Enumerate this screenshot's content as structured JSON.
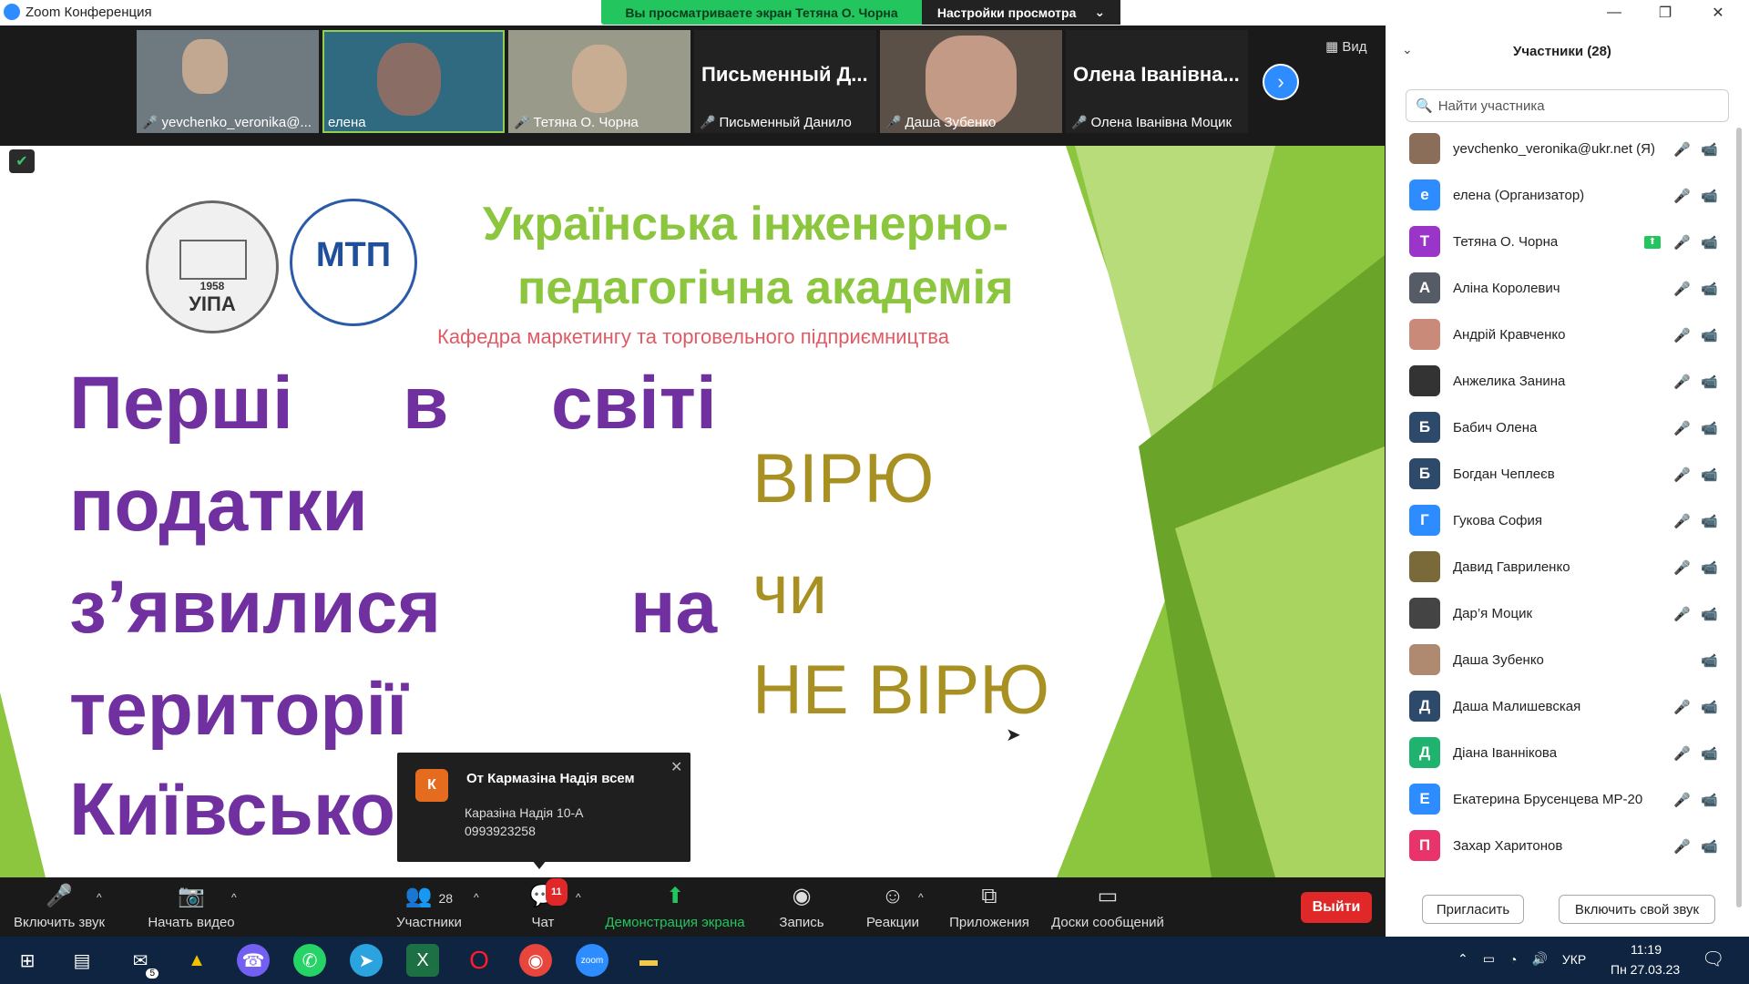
{
  "window": {
    "title": "Zoom Конференция",
    "share_banner": "Вы просматриваете экран Тетяна О. Чорна",
    "view_settings": "Настройки просмотра",
    "minimize": "—",
    "restore": "❐",
    "close": "✕"
  },
  "video_strip": {
    "view_label": "Вид",
    "tiles": [
      {
        "name": "yevchenko_veronika@...",
        "muted": true
      },
      {
        "name": "елена",
        "muted": false
      },
      {
        "name": "Тетяна О. Чорна",
        "muted": true
      },
      {
        "name": "Письменный Данило",
        "big_name": "Письменный Д...",
        "muted": true
      },
      {
        "name": "Даша Зубенко",
        "muted": true
      },
      {
        "name": "Олена Іванівна Моцик",
        "big_name": "Олена Іванівна...",
        "muted": true
      }
    ]
  },
  "slide": {
    "title_line1": "Українська інженерно-",
    "title_line2": "педагогічна академія",
    "subtitle": "Кафедра маркетингу та торговельного підприємництва",
    "logo1_text": "УІПА",
    "logo1_year": "1958",
    "logo2_text": "МТП",
    "words": [
      "Перші",
      "в",
      "світі",
      "податки",
      "з’явилися",
      "на",
      "території",
      "Київсько"
    ],
    "vote_yes": "ВІРЮ",
    "vote_or": "чи",
    "vote_no": "НЕ ВІРЮ"
  },
  "chat_popup": {
    "avatar": "К",
    "from": "От Кармазіна Надія всем",
    "line1": "Каразіна Надія 10-А",
    "line2": "0993923258"
  },
  "toolbar": {
    "unmute": "Включить звук",
    "start_video": "Начать видео",
    "participants": "Участники",
    "participants_count": "28",
    "chat": "Чат",
    "chat_badge": "11",
    "share_screen": "Демонстрация экрана",
    "record": "Запись",
    "reactions": "Реакции",
    "apps": "Приложения",
    "whiteboards": "Доски сообщений",
    "leave": "Выйти"
  },
  "participants_panel": {
    "title": "Участники (28)",
    "search_placeholder": "Найти участника",
    "invite": "Пригласить",
    "unmute_self": "Включить свой звук",
    "people": [
      {
        "name": "yevchenko_veronika@ukr.net (Я)",
        "initial": "",
        "color": "#8a6e5a",
        "mic": "off",
        "cam": "off"
      },
      {
        "name": "елена (Организатор)",
        "initial": "е",
        "color": "#2d8cff",
        "mic": "on",
        "cam": "on"
      },
      {
        "name": "Тетяна О. Чорна",
        "initial": "Т",
        "color": "#9b35c9",
        "mic": "off",
        "cam": "on",
        "sharing": true
      },
      {
        "name": "Аліна Королевич",
        "initial": "А",
        "color": "#555c66",
        "mic": "off",
        "cam": "off"
      },
      {
        "name": "Андрій Кравченко",
        "initial": "",
        "color": "#c98a7a",
        "mic": "off",
        "cam": "off"
      },
      {
        "name": "Анжелика Занина",
        "initial": "",
        "color": "#333333",
        "mic": "off",
        "cam": "off"
      },
      {
        "name": "Бабич Олена",
        "initial": "Б",
        "color": "#2d4a6b",
        "mic": "off",
        "cam": "off"
      },
      {
        "name": "Богдан Чеплеєв",
        "initial": "Б",
        "color": "#2d4a6b",
        "mic": "off",
        "cam": "off"
      },
      {
        "name": "Гукова София",
        "initial": "Г",
        "color": "#2d8cff",
        "mic": "off",
        "cam": "off"
      },
      {
        "name": "Давид Гавриленко",
        "initial": "",
        "color": "#7a6a3a",
        "mic": "off",
        "cam": "off"
      },
      {
        "name": "Дар’я Моцик",
        "initial": "",
        "color": "#444444",
        "mic": "off",
        "cam": "off"
      },
      {
        "name": "Даша Зубенко",
        "initial": "",
        "color": "#b08a70",
        "mic": "none",
        "cam": "off"
      },
      {
        "name": "Даша Малишевская",
        "initial": "Д",
        "color": "#2d4a6b",
        "mic": "off",
        "cam": "off"
      },
      {
        "name": "Діана Іваннікова",
        "initial": "Д",
        "color": "#1fb36f",
        "mic": "off",
        "cam": "off"
      },
      {
        "name": "Екатерина Брусенцева МР-20",
        "initial": "Е",
        "color": "#2d8cff",
        "mic": "off",
        "cam": "off"
      },
      {
        "name": "Захар Харитонов",
        "initial": "П",
        "color": "#e8336b",
        "mic": "off",
        "cam": "off"
      }
    ]
  },
  "taskbar": {
    "language": "УКР",
    "time": "11:19",
    "date": "Пн 27.03.23",
    "mail_badge": "5"
  }
}
